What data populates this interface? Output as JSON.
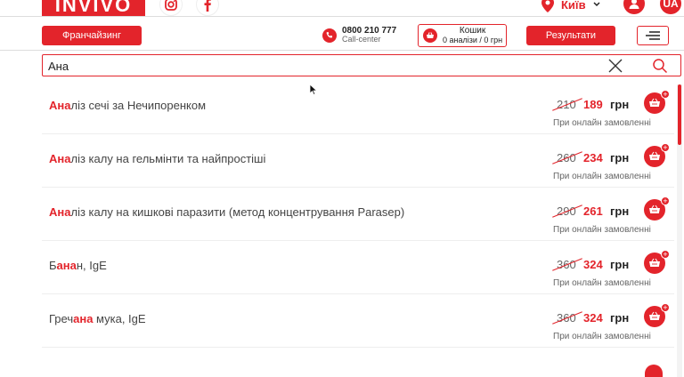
{
  "header": {
    "logo": "INVIVO",
    "city": "Київ",
    "lang": "UA",
    "franchise_label": "Франчайзинг",
    "phone_number": "0800 210 777",
    "phone_sub": "Call-center",
    "cart_title": "Кошик",
    "cart_summary": "0 аналізи / 0 грн",
    "results_label": "Результати"
  },
  "search": {
    "value": "Ана",
    "placeholder": ""
  },
  "results": [
    {
      "pre": "",
      "hl": "Ана",
      "post": "ліз сечі за Нечипоренком",
      "old": "210",
      "new": "189",
      "cur": "грн",
      "note": "При онлайн замовленні"
    },
    {
      "pre": "",
      "hl": "Ана",
      "post": "ліз калу на гельмінти та найпростіші",
      "old": "260",
      "new": "234",
      "cur": "грн",
      "note": "При онлайн замовленні"
    },
    {
      "pre": "",
      "hl": "Ана",
      "post": "ліз калу на кишкові паразити (метод концентрування Parasep)",
      "old": "290",
      "new": "261",
      "cur": "грн",
      "note": "При онлайн замовленні"
    },
    {
      "pre": "Б",
      "hl": "ана",
      "post": "н, IgE",
      "old": "360",
      "new": "324",
      "cur": "грн",
      "note": "При онлайн замовленні"
    },
    {
      "pre": "Греч",
      "hl": "ана",
      "post": " мука, IgE",
      "old": "360",
      "new": "324",
      "cur": "грн",
      "note": "При онлайн замовленні"
    }
  ],
  "colors": {
    "accent": "#e3242b"
  }
}
